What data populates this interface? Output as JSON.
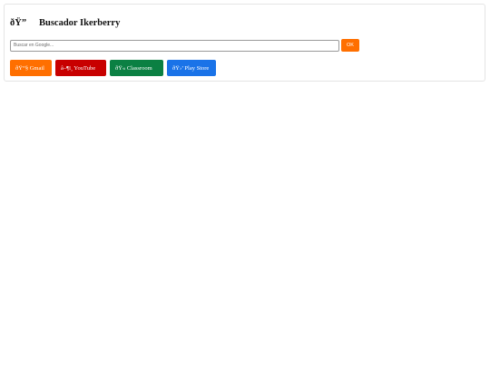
{
  "header": {
    "emoji": "ðŸ”",
    "title": "Buscador Ikerberry"
  },
  "search": {
    "placeholder": "Buscar en Google...",
    "value": "",
    "button_label": "OK",
    "button_color": "#ff6f00"
  },
  "links": [
    {
      "label": "ðŸ“§ Gmail",
      "color": "#ff6f00"
    },
    {
      "label": "â–¶ï¸ YouTube",
      "color": "#c80000"
    },
    {
      "label": "ðŸ« Classroom",
      "color": "#0b8043"
    },
    {
      "label": "ðŸ›’ Play Store",
      "color": "#1a73e8"
    }
  ]
}
